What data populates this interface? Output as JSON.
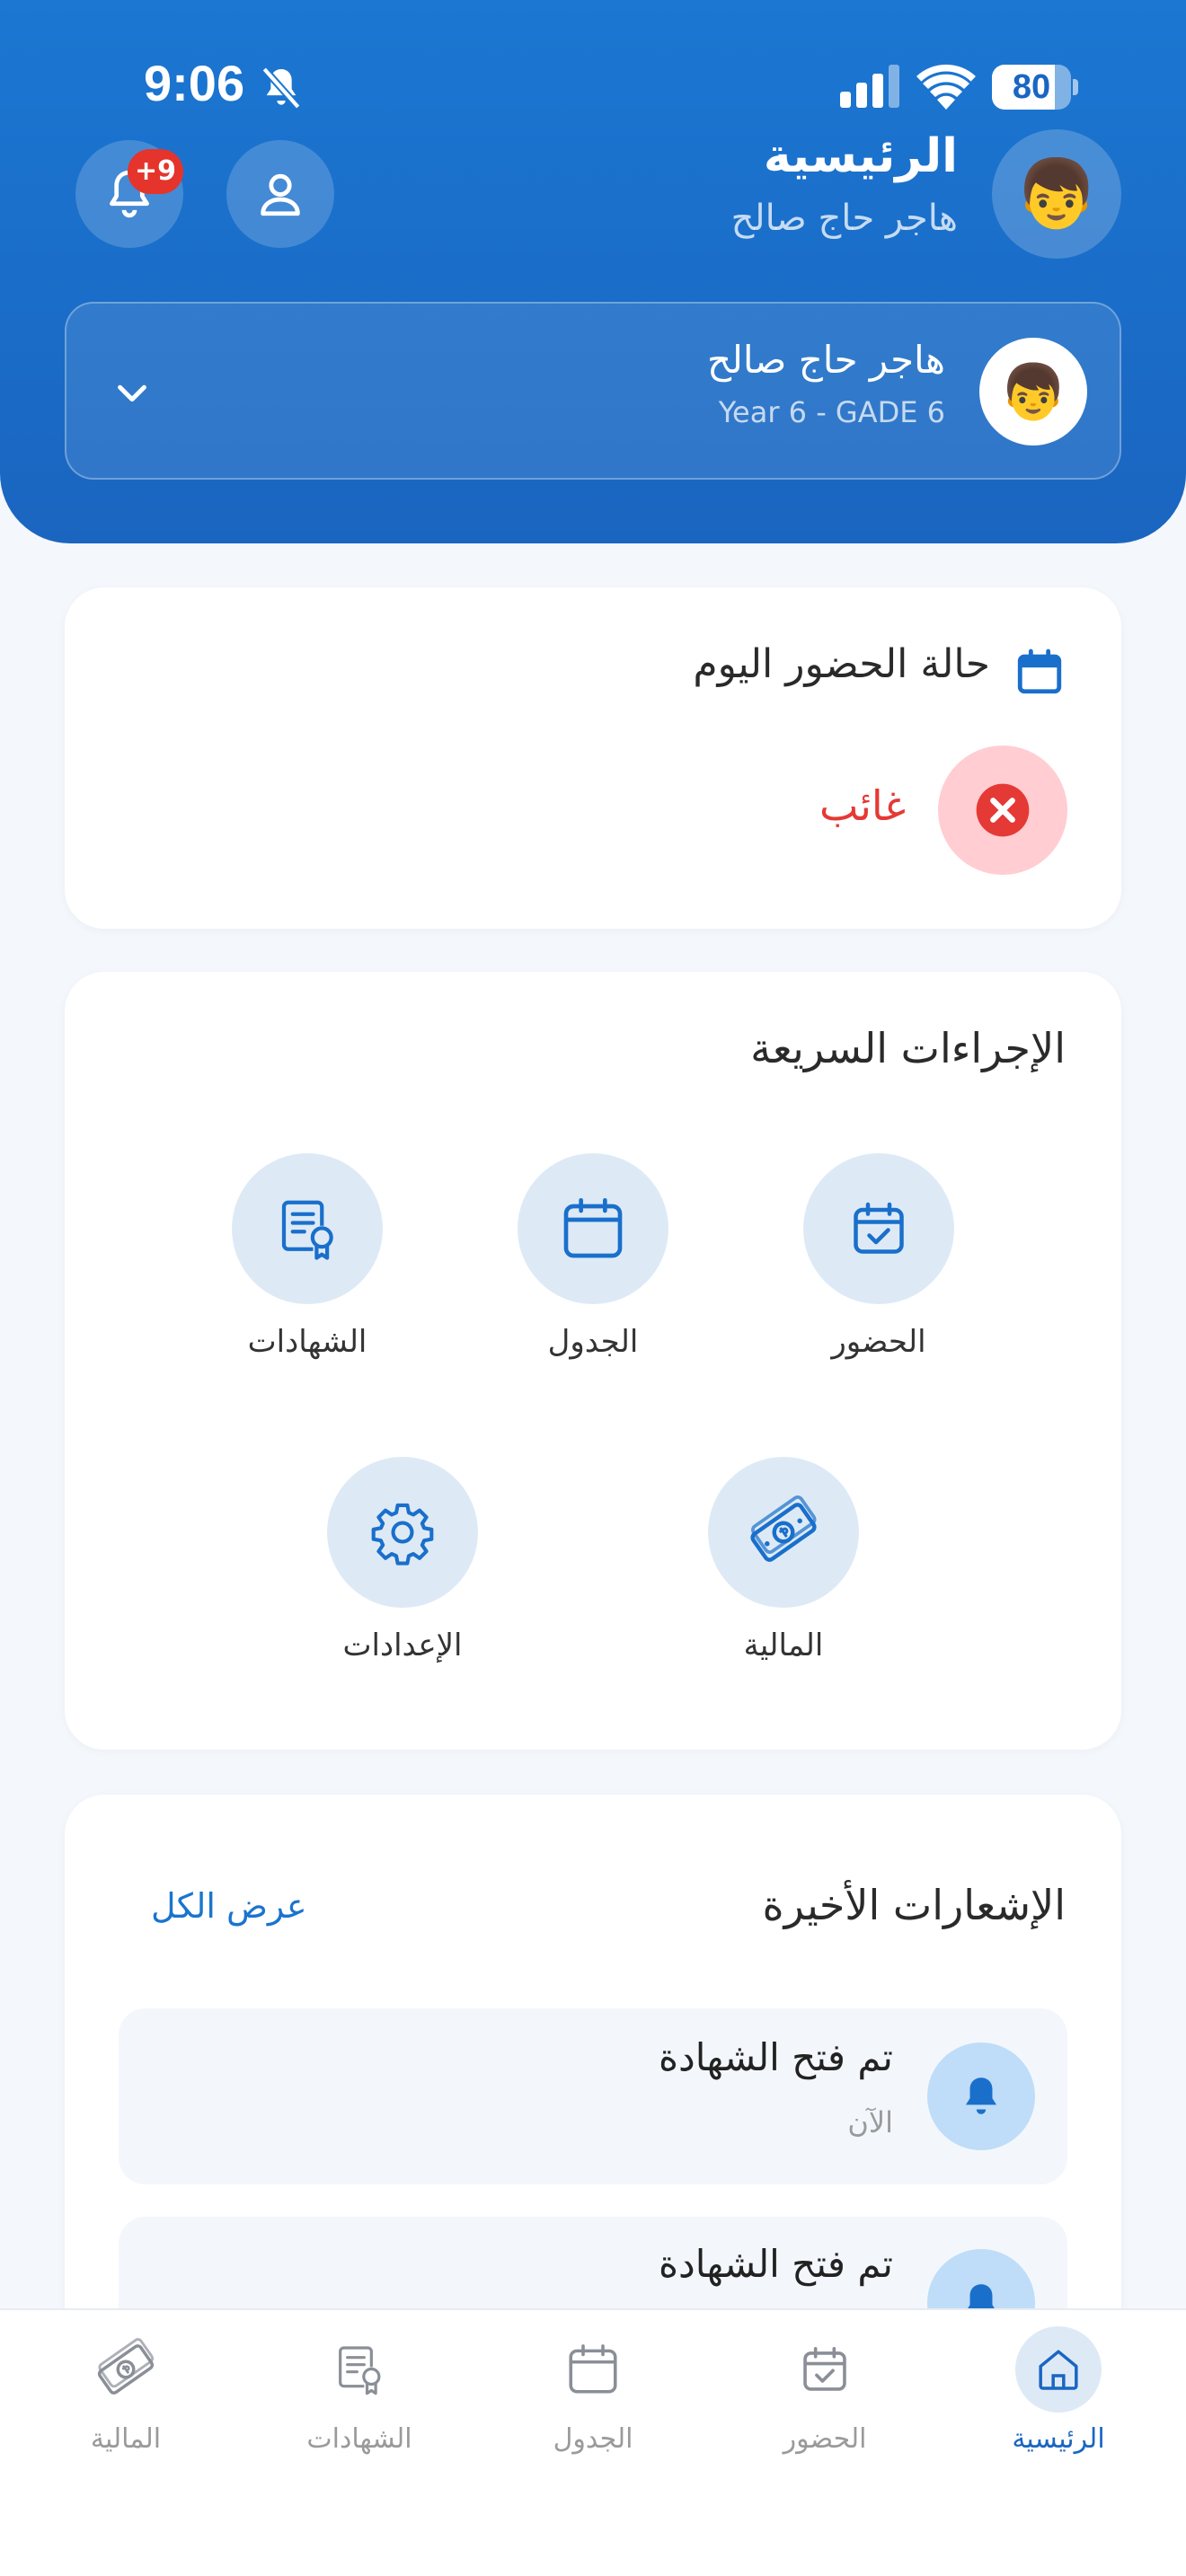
{
  "status_bar": {
    "time": "9:06",
    "battery": "80",
    "battery_level": 0.8
  },
  "header": {
    "title": "الرئيسية",
    "subtitle": "هاجر حاج صالح",
    "notification_badge": "+9",
    "avatar_emoji": "👦"
  },
  "student_selector": {
    "name": "هاجر حاج صالح",
    "grade": "Year 6 - GADE 6",
    "avatar_emoji": "👦"
  },
  "attendance": {
    "title": "حالة الحضور اليوم",
    "status": "غائب"
  },
  "quick_actions": {
    "title": "الإجراءات السريعة",
    "items": [
      {
        "label": "الحضور",
        "icon": "calendar-check-icon"
      },
      {
        "label": "الجدول",
        "icon": "calendar-icon"
      },
      {
        "label": "الشهادات",
        "icon": "certificate-icon"
      },
      {
        "label": "المالية",
        "icon": "money-icon"
      },
      {
        "label": "الإعدادات",
        "icon": "gear-icon"
      }
    ]
  },
  "notifications": {
    "title": "الإشعارات الأخيرة",
    "view_all": "عرض الكل",
    "items": [
      {
        "title": "تم فتح الشهادة",
        "time": "الآن"
      },
      {
        "title": "تم فتح الشهادة"
      }
    ]
  },
  "bottom_nav": {
    "items": [
      {
        "label": "الرئيسية",
        "icon": "home-icon",
        "active": true
      },
      {
        "label": "الحضور",
        "icon": "calendar-check-icon"
      },
      {
        "label": "الجدول",
        "icon": "calendar-icon"
      },
      {
        "label": "الشهادات",
        "icon": "certificate-icon"
      },
      {
        "label": "المالية",
        "icon": "money-icon"
      }
    ]
  },
  "colors": {
    "primary": "#1A6FCB",
    "absent_red": "#E53935",
    "absent_bg": "#FFCDD2",
    "icon_bg": "#DDEAF6",
    "badge_red": "#E5342B"
  }
}
